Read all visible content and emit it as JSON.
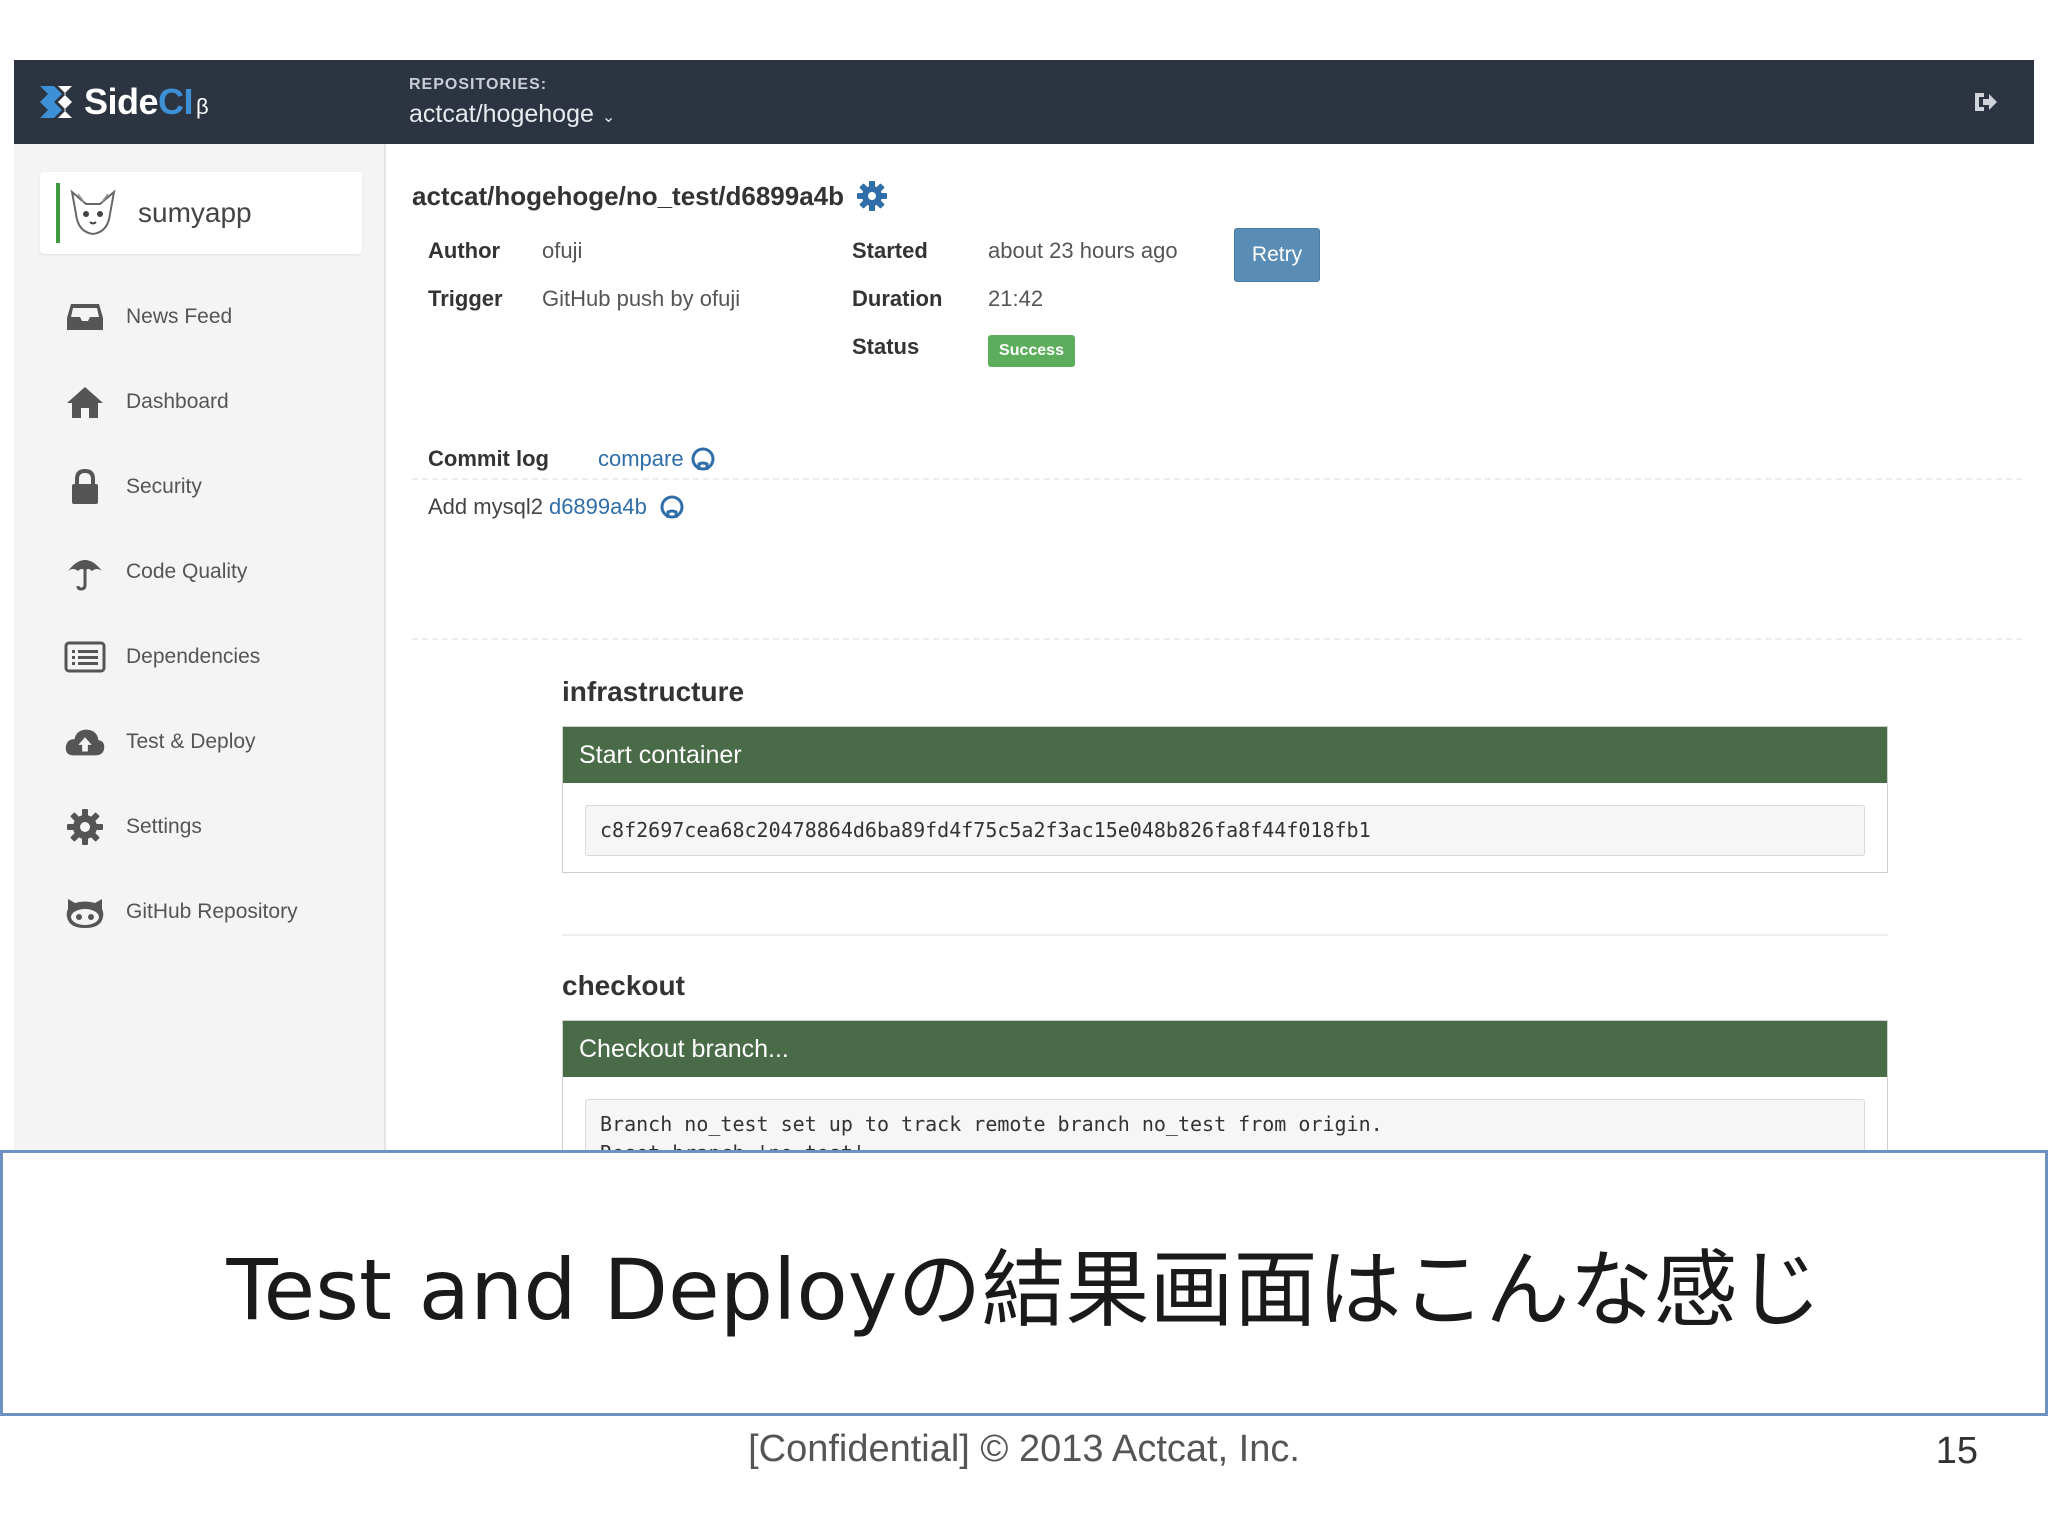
{
  "header": {
    "logo_text_side": "Side",
    "logo_text_ci": "CI",
    "logo_beta": "β",
    "repositories_label": "REPOSITORIES:",
    "repository": "actcat/hogehoge",
    "logout_icon": "sign-out-icon"
  },
  "sidebar": {
    "org_name": "sumyapp",
    "items": [
      {
        "label": "News Feed",
        "icon": "inbox-icon"
      },
      {
        "label": "Dashboard",
        "icon": "home-icon"
      },
      {
        "label": "Security",
        "icon": "lock-icon"
      },
      {
        "label": "Code Quality",
        "icon": "umbrella-icon"
      },
      {
        "label": "Dependencies",
        "icon": "list-icon"
      },
      {
        "label": "Test & Deploy",
        "icon": "cloud-upload-icon"
      },
      {
        "label": "Settings",
        "icon": "gear-icon"
      },
      {
        "label": "GitHub Repository",
        "icon": "github-icon"
      }
    ]
  },
  "job": {
    "title": "actcat/hogehoge/no_test/d6899a4b",
    "author_label": "Author",
    "author": "ofuji",
    "trigger_label": "Trigger",
    "trigger": "GitHub push by ofuji",
    "started_label": "Started",
    "started": "about 23 hours ago",
    "duration_label": "Duration",
    "duration": "21:42",
    "status_label": "Status",
    "status": "Success",
    "retry_label": "Retry"
  },
  "commits": {
    "label": "Commit log",
    "compare_label": "compare",
    "message": "Add mysql2",
    "sha": "d6899a4b"
  },
  "sections": [
    {
      "title": "infrastructure",
      "step": "Start container",
      "output": "c8f2697cea68c20478864d6ba89fd4f75c5a2f3ac15e048b826fa8f44f018fb1"
    },
    {
      "title": "checkout",
      "step": "Checkout branch...",
      "output": "Branch no_test set up to track remote branch no_test from origin.\nReset branch 'no_test'\nYour branch is up-to-date with 'origin/no_test'."
    }
  ],
  "slide": {
    "caption": "Test and Deployの結果画面はこんな感じ",
    "footer": "[Confidential] © 2013 Actcat, Inc.",
    "page_number": "15"
  },
  "colors": {
    "topbar": "#2b3440",
    "step_header": "#4a6b47",
    "success": "#5cae5c",
    "retry": "#5a8db6",
    "link": "#2f6ea8"
  }
}
